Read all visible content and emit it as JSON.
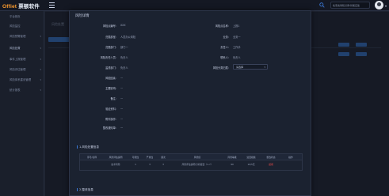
{
  "app": {
    "logo_prefix": "Offiet",
    "logo_name": "票额软件"
  },
  "topbar": {
    "search_value": "检索案例知识库/智能应答"
  },
  "sidebar": {
    "items": [
      {
        "label": "平台首页"
      },
      {
        "label": "风险监控"
      },
      {
        "label": "风险预警管理"
      },
      {
        "label": "风险处置"
      },
      {
        "label": "事件上报管理"
      },
      {
        "label": "风险评估管理"
      },
      {
        "label": "风险体系建设管理"
      },
      {
        "label": "统计报表"
      }
    ]
  },
  "background": {
    "tab_label": "风险处置"
  },
  "modal": {
    "title": "风险详情",
    "fields_left": [
      {
        "label": "风险点编号：",
        "value": "XXX"
      },
      {
        "label": "归属部室：",
        "value": "人员办公风险"
      },
      {
        "label": "归属部门：",
        "value": "部门一"
      },
      {
        "label": "风险责任人员：",
        "value": "负责人"
      },
      {
        "label": "监督部门：",
        "value": "负责人"
      },
      {
        "label": "风险因素：",
        "value": "—"
      },
      {
        "label": "主要影响：",
        "value": "—"
      },
      {
        "label": "备注：",
        "value": "—"
      },
      {
        "label": "验证资料：",
        "value": "—"
      },
      {
        "label": "附件操作：",
        "value": "—"
      },
      {
        "label": "整改通知单：",
        "value": "—"
      }
    ],
    "fields_right": [
      {
        "label": "风险点名称：",
        "value": "上报1"
      },
      {
        "label": "业务：",
        "value": "业务一"
      },
      {
        "label": "责任人：",
        "value": "工作手"
      },
      {
        "label": "联系人：",
        "value": "负责人"
      }
    ],
    "select_label": "风险分类归属：",
    "select_value": "请选择",
    "section1_title": "1.风险处置信息",
    "table": {
      "headers": [
        "序号/名称",
        "风险评估说明",
        "可能性",
        "严重性",
        "频次",
        "风险值",
        "风险等级",
        "处置措施",
        "整改状态",
        "操作"
      ],
      "row": [
        "",
        "技术风险",
        "1",
        "3",
        "3",
        "风险评估说明/分析报告（1-7）",
        "90",
        "10/5天",
        "超期",
        ""
      ]
    },
    "section2_title": "2.整改信息"
  }
}
